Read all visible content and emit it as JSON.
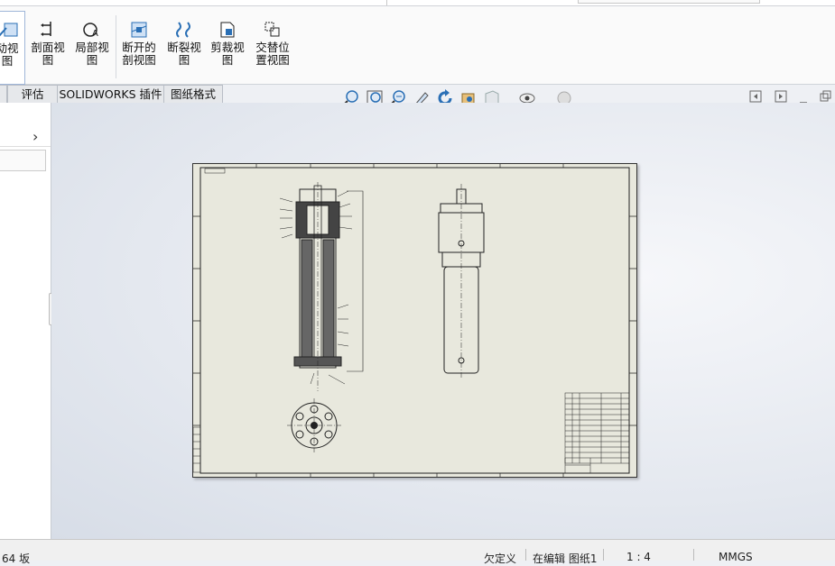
{
  "ribbon": {
    "buttons": [
      {
        "label": "动视\n图",
        "icon": "auto-view-icon",
        "active": true
      },
      {
        "label": "剖面视\n图",
        "icon": "section-view-icon"
      },
      {
        "label": "局部视\n图",
        "icon": "detail-view-icon"
      },
      {
        "label": "断开的\n剖视图",
        "icon": "broken-out-section-icon"
      },
      {
        "label": "断裂视\n图",
        "icon": "break-view-icon"
      },
      {
        "label": "剪裁视\n图",
        "icon": "crop-view-icon"
      },
      {
        "label": "交替位\n置视图",
        "icon": "alternate-position-view-icon"
      }
    ]
  },
  "tabs": [
    "评估",
    "SOLIDWORKS 插件",
    "图纸格式"
  ],
  "view_tools": [
    "zoom-to-fit-icon",
    "zoom-to-area-icon",
    "zoom-in-out-icon",
    "pan-icon",
    "rotate-icon",
    "previous-view-icon",
    "view-orientation-icon",
    "hide-show-items-icon",
    "appearance-icon"
  ],
  "status": {
    "left": "64 坂",
    "defined": "欠定义",
    "editing": "在编辑 图纸1",
    "scale": "1 : 4",
    "units": "MMGS"
  },
  "colors": {
    "sheet": "#e8e8dd",
    "line": "#222222",
    "accent": "#2a6fb5"
  }
}
